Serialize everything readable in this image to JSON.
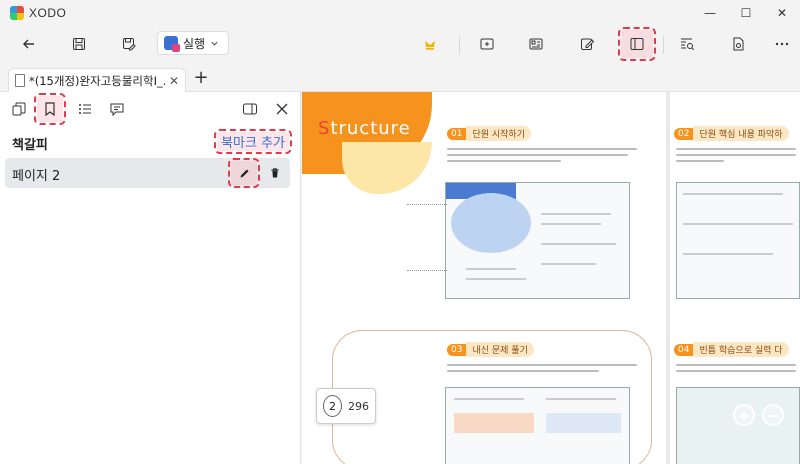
{
  "app": {
    "name": "XODO"
  },
  "window_controls": {
    "minimize": "—",
    "maximize": "☐",
    "close": "✕"
  },
  "toolbar": {
    "action_select_label": "실행",
    "buttons": [
      "back-icon",
      "save-icon",
      "save-as-icon",
      "lightbulb-icon",
      "insert-page-icon",
      "compare-icon",
      "edit-icon",
      "side-panel-icon",
      "search-panel-icon",
      "document-info-icon",
      "more-icon"
    ]
  },
  "tab": {
    "title": "*(15개정)완자고등물리학Ⅰ_...",
    "close": "✕",
    "new_tab": "+"
  },
  "side_panel": {
    "title": "책갈피",
    "add_bookmark_label": "북마크 추가",
    "bookmarks": [
      {
        "label": "페이지 2"
      }
    ]
  },
  "document": {
    "structure_first_letter": "S",
    "structure_rest": "tructure",
    "sections": [
      {
        "num": "01",
        "title": "단원 시작하기"
      },
      {
        "num": "02",
        "title": "단원 핵심 내용 파악하"
      },
      {
        "num": "03",
        "title": "내신 문제 풀기"
      },
      {
        "num": "04",
        "title": "빈틈 학습으로 실력 다"
      }
    ]
  },
  "page_indicator": {
    "current": "2",
    "total": "296"
  },
  "colors": {
    "accent_orange": "#f6921e",
    "highlight_red": "#e03c4c",
    "link_blue": "#2d6fd4"
  }
}
